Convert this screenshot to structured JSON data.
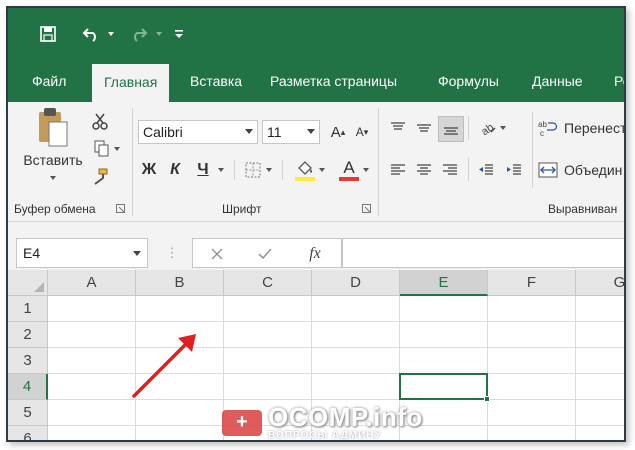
{
  "qat": {
    "undo_icon": "undo-arrow-icon",
    "redo_icon": "redo-arrow-icon"
  },
  "tabs": [
    "Файл",
    "Главная",
    "Вставка",
    "Разметка страницы",
    "Формулы",
    "Данные",
    "Ре"
  ],
  "ribbon": {
    "clipboard": {
      "paste_label": "Вставить",
      "group_label": "Буфер обмена"
    },
    "font": {
      "font_name": "Calibri",
      "font_size": "11",
      "bold": "Ж",
      "italic": "К",
      "underline": "Ч",
      "group_label": "Шрифт",
      "highlight_color": "#ffeb3b",
      "font_color": "#e53935"
    },
    "alignment": {
      "wrap_label": "Перенест",
      "merge_label": "Объедин",
      "group_label": "Выравниван"
    }
  },
  "formula_bar": {
    "name_box": "E4",
    "fx_label": "fx",
    "cancel_icon": "close-icon",
    "enter_icon": "check-icon"
  },
  "grid": {
    "columns": [
      "A",
      "B",
      "C",
      "D",
      "E",
      "F",
      "G"
    ],
    "rows": [
      "1",
      "2",
      "3",
      "4",
      "5",
      "6"
    ],
    "selected_column": "E",
    "selected_row": "4"
  },
  "watermark": {
    "main": "OCOMP.info",
    "sub": "ВОПРОСЫ АДМИНУ"
  },
  "colors": {
    "accent": "#217346",
    "arrow": "#e02020"
  }
}
